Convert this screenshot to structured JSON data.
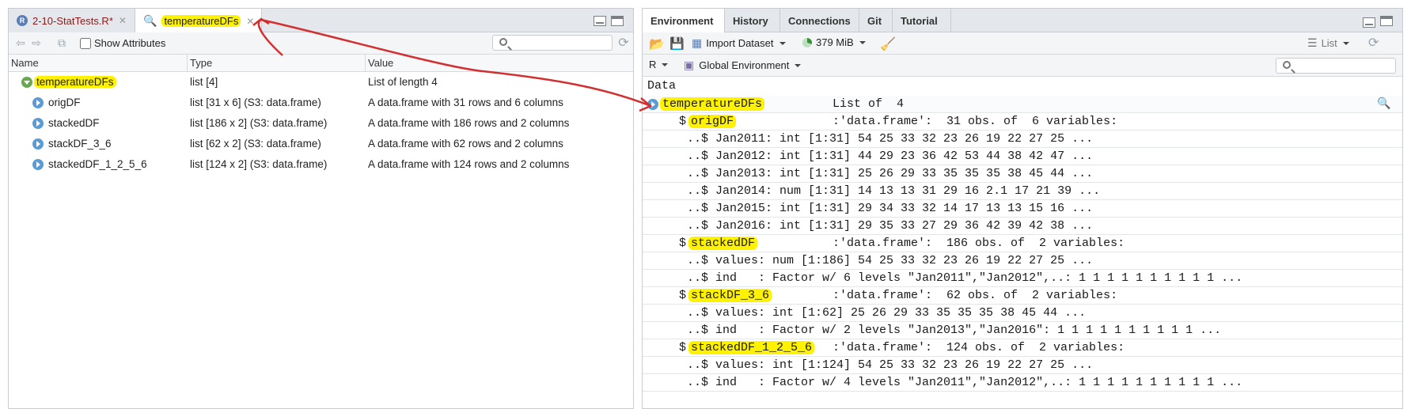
{
  "left": {
    "tabs": [
      {
        "label": "2-10-StatTests.R*",
        "icon": "r-file-icon"
      },
      {
        "label": "temperatureDFs",
        "icon": "magnifier-icon"
      }
    ],
    "toolbar": {
      "show_attributes": "Show Attributes"
    },
    "columns": {
      "name": "Name",
      "type": "Type",
      "value": "Value"
    },
    "rows": [
      {
        "name": "temperatureDFs",
        "type": "list [4]",
        "value": "List of length 4"
      },
      {
        "name": "origDF",
        "type": "list [31 x 6] (S3: data.frame)",
        "value": "A data.frame with 31 rows and 6 columns"
      },
      {
        "name": "stackedDF",
        "type": "list [186 x 2] (S3: data.frame)",
        "value": "A data.frame with 186 rows and 2 columns"
      },
      {
        "name": "stackDF_3_6",
        "type": "list [62 x 2] (S3: data.frame)",
        "value": "A data.frame with 62 rows and 2 columns"
      },
      {
        "name": "stackedDF_1_2_5_6",
        "type": "list [124 x 2] (S3: data.frame)",
        "value": "A data.frame with 124 rows and 2 columns"
      }
    ]
  },
  "right": {
    "tabs": [
      "Environment",
      "History",
      "Connections",
      "Git",
      "Tutorial"
    ],
    "toolbar": {
      "import_dataset": "Import Dataset",
      "memory": "379 MiB",
      "list_view": "List",
      "language": "R",
      "environment": "Global Environment"
    },
    "section": "Data",
    "object": {
      "name": "temperatureDFs",
      "summary": "List of  4"
    },
    "lines": {
      "origdf_name": "origDF",
      "origdf_desc": ":'data.frame':\t31 obs. of  6 variables:",
      "jan2011": "..$ Jan2011: int [1:31] 54 25 33 32 23 26 19 22 27 25 ...",
      "jan2012": "..$ Jan2012: int [1:31] 44 29 23 36 42 53 44 38 42 47 ...",
      "jan2013": "..$ Jan2013: int [1:31] 25 26 29 33 35 35 35 38 45 44 ...",
      "jan2014": "..$ Jan2014: num [1:31] 14 13 13 31 29 16 2.1 17 21 39 ...",
      "jan2015": "..$ Jan2015: int [1:31] 29 34 33 32 14 17 13 13 15 16 ...",
      "jan2016": "..$ Jan2016: int [1:31] 29 35 33 27 29 36 42 39 42 38 ...",
      "stackeddf_name": "stackedDF",
      "stackeddf_desc": ":'data.frame':\t186 obs. of  2 variables:",
      "stackeddf_values": "..$ values: num [1:186] 54 25 33 32 23 26 19 22 27 25 ...",
      "stackeddf_ind": "..$ ind   : Factor w/ 6 levels \"Jan2011\",\"Jan2012\",..: 1 1 1 1 1 1 1 1 1 1 ...",
      "stackdf36_name": "stackDF_3_6",
      "stackdf36_desc": ":'data.frame':\t62 obs. of  2 variables:",
      "stackdf36_values": "..$ values: int [1:62] 25 26 29 33 35 35 35 38 45 44 ...",
      "stackdf36_ind": "..$ ind   : Factor w/ 2 levels \"Jan2013\",\"Jan2016\": 1 1 1 1 1 1 1 1 1 1 ...",
      "stackeddf1256_name": "stackedDF_1_2_5_6",
      "stackeddf1256_desc": ":'data.frame':\t124 obs. of  2 variables:",
      "stackeddf1256_values": "..$ values: int [1:124] 54 25 33 32 23 26 19 22 27 25 ...",
      "stackeddf1256_ind": "..$ ind   : Factor w/ 4 levels \"Jan2011\",\"Jan2012\",..: 1 1 1 1 1 1 1 1 1 1 ..."
    }
  },
  "annotation": {
    "highlight_color": "#fff200",
    "arrow_color": "#d32f2f"
  }
}
